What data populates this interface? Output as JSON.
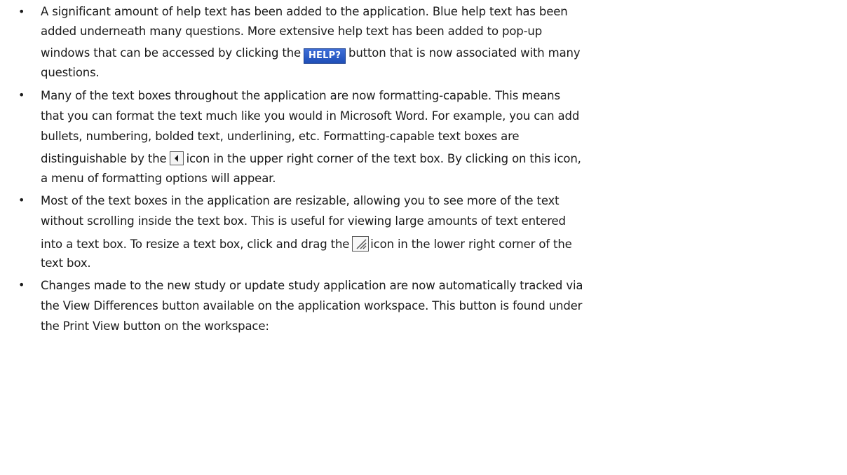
{
  "bullet_char": "•",
  "bullets": [
    {
      "lines": [
        "A significant amount of help text has been added to the application.  Blue help text has been",
        "added underneath many questions.  More extensive help text has been added to pop-up",
        "windows that can be accessed by clicking the",
        "button that is now associated with many",
        "questions."
      ]
    },
    {
      "lines": [
        "Many of the text boxes throughout the application are now formatting-capable.  This means",
        "that you can format the text much like you would in Microsoft Word.  For example, you can add",
        "bullets, numbering, bolded text, underlining, etc.  Formatting-capable text boxes are",
        "distinguishable by the",
        "icon in the upper right corner of the text box.  By clicking on this icon,",
        "a menu of formatting options will appear."
      ]
    },
    {
      "lines": [
        "Most of the text boxes in the application are resizable, allowing you to see more of the text",
        "without scrolling inside the text box.  This is useful for viewing large amounts of text entered",
        "into a text box.  To resize a text box, click and drag the",
        "icon in the lower right corner of the",
        "text box."
      ]
    },
    {
      "lines": [
        "Changes made to the new study or update study application are now automatically tracked via",
        "the View Differences button available on the application workspace.  This button is found under",
        "the Print View button on the workspace:"
      ]
    }
  ],
  "help_button_label": "HELP?",
  "icons": {
    "help": "help-button-icon",
    "format": "formatting-toggle-icon",
    "resize": "resize-handle-icon"
  },
  "colors": {
    "text": "#1a1a1a",
    "help_button_bg": "#2b5cc9",
    "help_button_text": "#ffffff"
  }
}
